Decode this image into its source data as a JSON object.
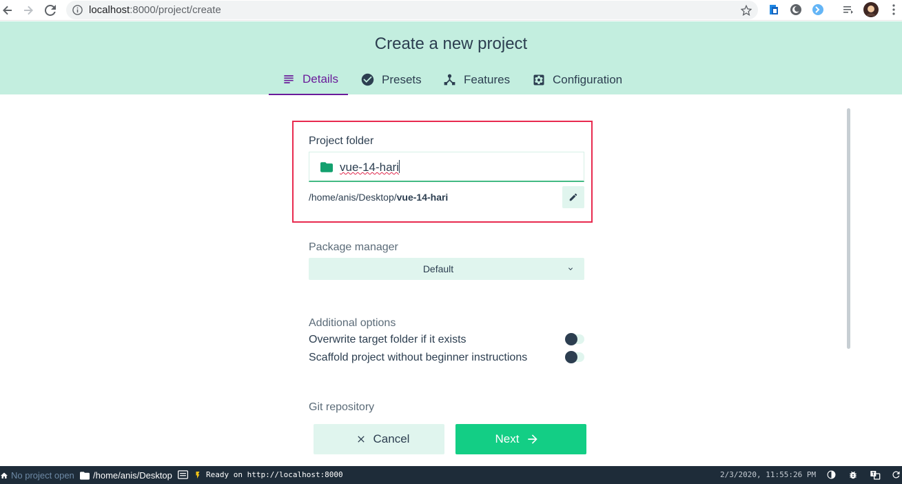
{
  "browser": {
    "url_host": "localhost",
    "url_path": ":8000/project/create"
  },
  "header": {
    "title": "Create a new project",
    "tabs": [
      {
        "label": "Details",
        "icon": "subject-icon",
        "active": true
      },
      {
        "label": "Presets",
        "icon": "check-circle-icon",
        "active": false
      },
      {
        "label": "Features",
        "icon": "device-hub-icon",
        "active": false
      },
      {
        "label": "Configuration",
        "icon": "settings-applications-icon",
        "active": false
      }
    ]
  },
  "form": {
    "project_folder": {
      "label": "Project folder",
      "value": "vue-14-hari",
      "path_prefix": "/home/anis/Desktop/",
      "path_name": "vue-14-hari"
    },
    "package_manager": {
      "label": "Package manager",
      "selected": "Default"
    },
    "additional_options": {
      "label": "Additional options",
      "options": [
        {
          "label": "Overwrite target folder if it exists",
          "enabled": false
        },
        {
          "label": "Scaffold project without beginner instructions",
          "enabled": false
        }
      ]
    },
    "git": {
      "label": "Git repository"
    }
  },
  "actions": {
    "cancel_label": "Cancel",
    "next_label": "Next"
  },
  "statusbar": {
    "project": "No project open",
    "cwd": "/home/anis/Desktop",
    "log": "Ready on http://localhost:8000",
    "time": "2/3/2020, 11:55:26 PM"
  },
  "colors": {
    "header_bg": "#c3eedf",
    "accent_green": "#13ce85",
    "active_tab": "#6a1b9a",
    "highlight": "#e8294e",
    "statusbar_bg": "#1e2c39"
  }
}
